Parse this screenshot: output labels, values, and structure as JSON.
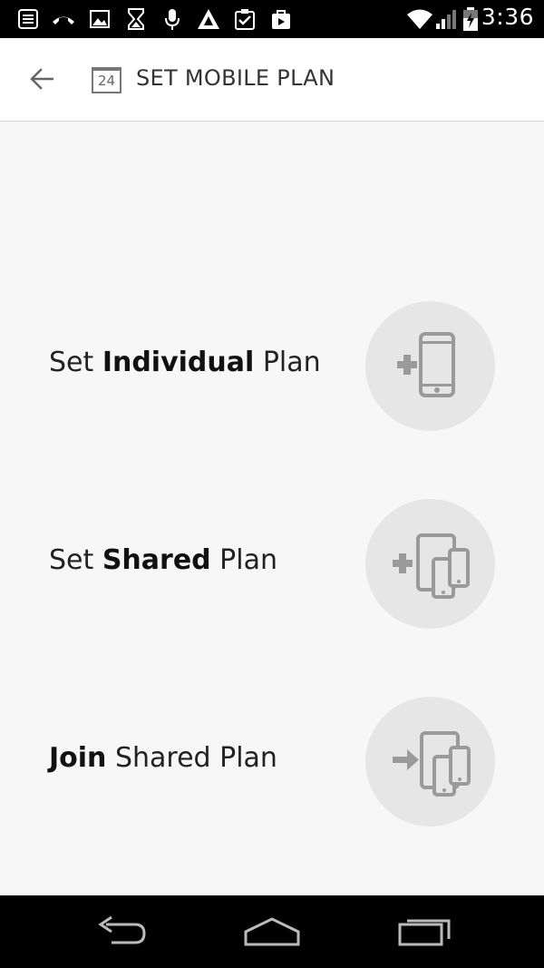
{
  "status_bar": {
    "time": "3:36",
    "icons": [
      "notification-list-icon",
      "missed-call-icon",
      "image-icon",
      "hourglass-icon",
      "microphone-icon",
      "triangle-app-icon",
      "clipboard-check-icon",
      "shopping-bag-icon",
      "wifi-icon",
      "signal-icon",
      "battery-charging-icon"
    ]
  },
  "app_bar": {
    "title": "SET MOBILE PLAN",
    "calendar_number": "24",
    "back_icon": "arrow-left-icon"
  },
  "options": [
    {
      "prefix": "Set ",
      "bold": "Individual",
      "suffix": " Plan",
      "icon": "add-phone-icon"
    },
    {
      "prefix": "Set ",
      "bold": "Shared",
      "suffix": " Plan",
      "icon": "add-multiple-devices-icon"
    },
    {
      "prefix": "",
      "bold": "Join",
      "suffix": " Shared Plan",
      "icon": "join-devices-icon"
    }
  ],
  "nav_bar": {
    "icons": [
      "back-nav-icon",
      "home-nav-icon",
      "recent-apps-icon"
    ]
  },
  "colors": {
    "background": "#f7f7f7",
    "app_bar": "#ffffff",
    "circle": "#e6e6e6",
    "icon_gray": "#9a9a9a"
  }
}
